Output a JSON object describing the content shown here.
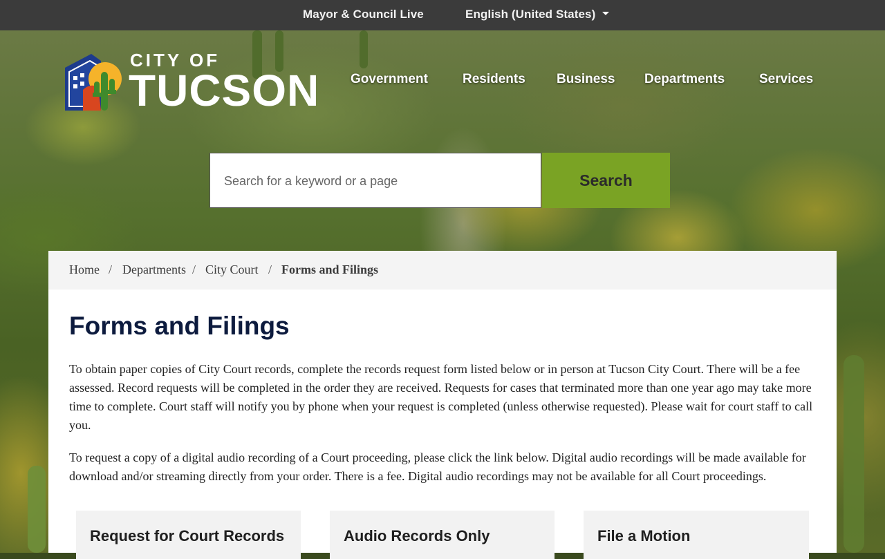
{
  "topbar": {
    "live_link": "Mayor & Council Live",
    "language": "English (United States)"
  },
  "logo": {
    "line1": "CITY OF",
    "line2": "TUCSON"
  },
  "nav": {
    "items": [
      "Government",
      "Residents",
      "Business",
      "Departments",
      "Services"
    ]
  },
  "search": {
    "placeholder": "Search for a keyword or a page",
    "button": "Search"
  },
  "breadcrumb": {
    "items": [
      "Home",
      "Departments",
      "City Court",
      "Forms and Filings"
    ]
  },
  "page": {
    "title": "Forms and Filings",
    "paragraph1": "To obtain paper copies of City Court records, complete the records request form listed below or in person at Tucson City Court. There will be a fee assessed. Record requests will be completed in the order they are received. Requests for cases that terminated more than one year ago may take more time to complete.  Court staff will notify you by phone when your request is completed (unless otherwise requested). Please wait for court staff to call you.",
    "paragraph2": "To request a copy of a digital audio recording of a Court proceeding, please click the link below.  Digital audio recordings will be made available for download and/or streaming directly from your order. There is a fee. Digital audio recordings may not be available for all Court proceedings."
  },
  "cards": [
    "Request for Court Records",
    "Audio Records Only",
    "File a Motion"
  ],
  "colors": {
    "topbar": "#3b3b3b",
    "search_button": "#7aa324",
    "title": "#0d1b3e"
  }
}
